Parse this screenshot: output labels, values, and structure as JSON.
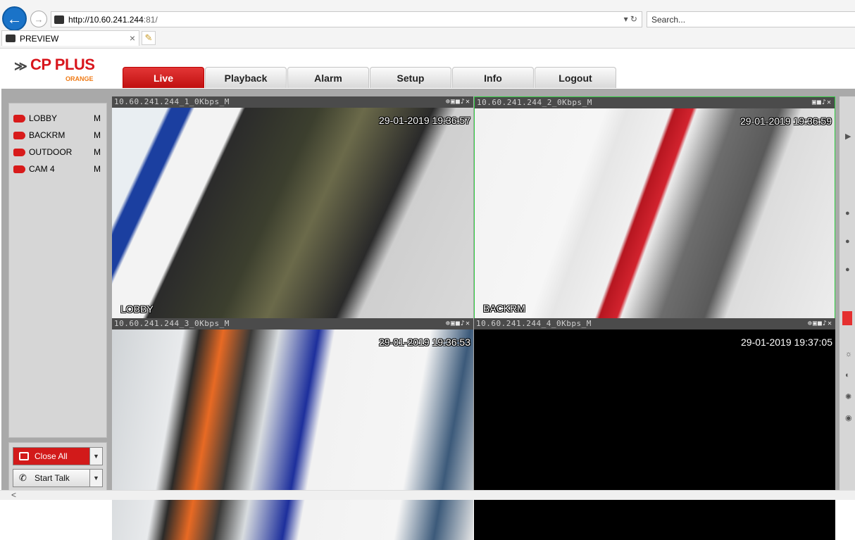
{
  "browser": {
    "url_host": "http://10.60.241.244",
    "url_port": ":81/",
    "search_placeholder": "Search...",
    "tab_title": "PREVIEW",
    "tab_close": "×"
  },
  "app": {
    "logo_text": "CP PLUS",
    "logo_sub": "ORANGE",
    "nav": [
      "Live",
      "Playback",
      "Alarm",
      "Setup",
      "Info",
      "Logout"
    ],
    "active_nav": "Live"
  },
  "sidebar": {
    "cameras": [
      {
        "name": "LOBBY",
        "stream": "M"
      },
      {
        "name": "BACKRM",
        "stream": "M"
      },
      {
        "name": "OUTDOOR",
        "stream": "M"
      },
      {
        "name": "CAM 4",
        "stream": "M"
      }
    ],
    "close_all": "Close All",
    "start_talk": "Start Talk"
  },
  "viewports": [
    {
      "title": "10.60.241.244_1_0Kbps_M",
      "timestamp": "29-01-2019 19:36:57",
      "label": "LOBBY"
    },
    {
      "title": "10.60.241.244_2_0Kbps_M",
      "timestamp": "29-01-2019 19:36:59",
      "label": "BACKRM"
    },
    {
      "title": "10.60.241.244_3_0Kbps_M",
      "timestamp": "29-01-2019 19:36:53",
      "label": ""
    },
    {
      "title": "10.60.241.244_4_0Kbps_M",
      "timestamp": "29-01-2019 19:37:05",
      "label": ""
    }
  ],
  "colors": {
    "accent": "#d21a1a",
    "selected_border": "#2ecc40"
  }
}
